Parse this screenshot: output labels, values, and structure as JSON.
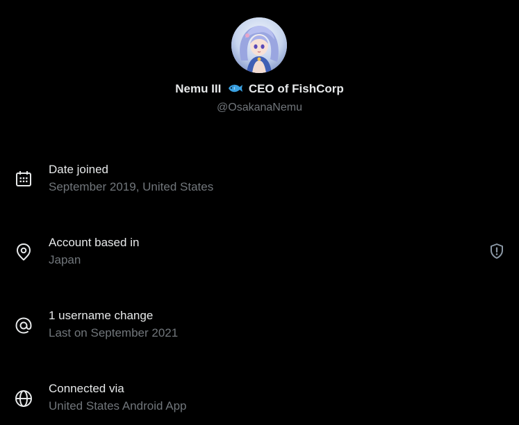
{
  "profile": {
    "display_name_prefix": "Nemu III",
    "display_name_suffix": "CEO of FishCorp",
    "name_emoji": "fish-emoji",
    "handle": "@OsakanaNemu",
    "avatar_icon": "avatar-anime-character"
  },
  "rows": [
    {
      "icon": "calendar-icon",
      "title": "Date joined",
      "subtitle": "September 2019, United States"
    },
    {
      "icon": "location-pin-icon",
      "title": "Account based in",
      "subtitle": "Japan",
      "trailing_icon": "shield-alert-icon"
    },
    {
      "icon": "at-sign-icon",
      "title": "1 username change",
      "subtitle": "Last on September 2021"
    },
    {
      "icon": "globe-icon",
      "title": "Connected via",
      "subtitle": "United States Android App"
    }
  ],
  "colors": {
    "background": "#000000",
    "primary_text": "#e7e9ea",
    "secondary_text": "#71767b",
    "fish_emoji": "#3aa0e0"
  }
}
